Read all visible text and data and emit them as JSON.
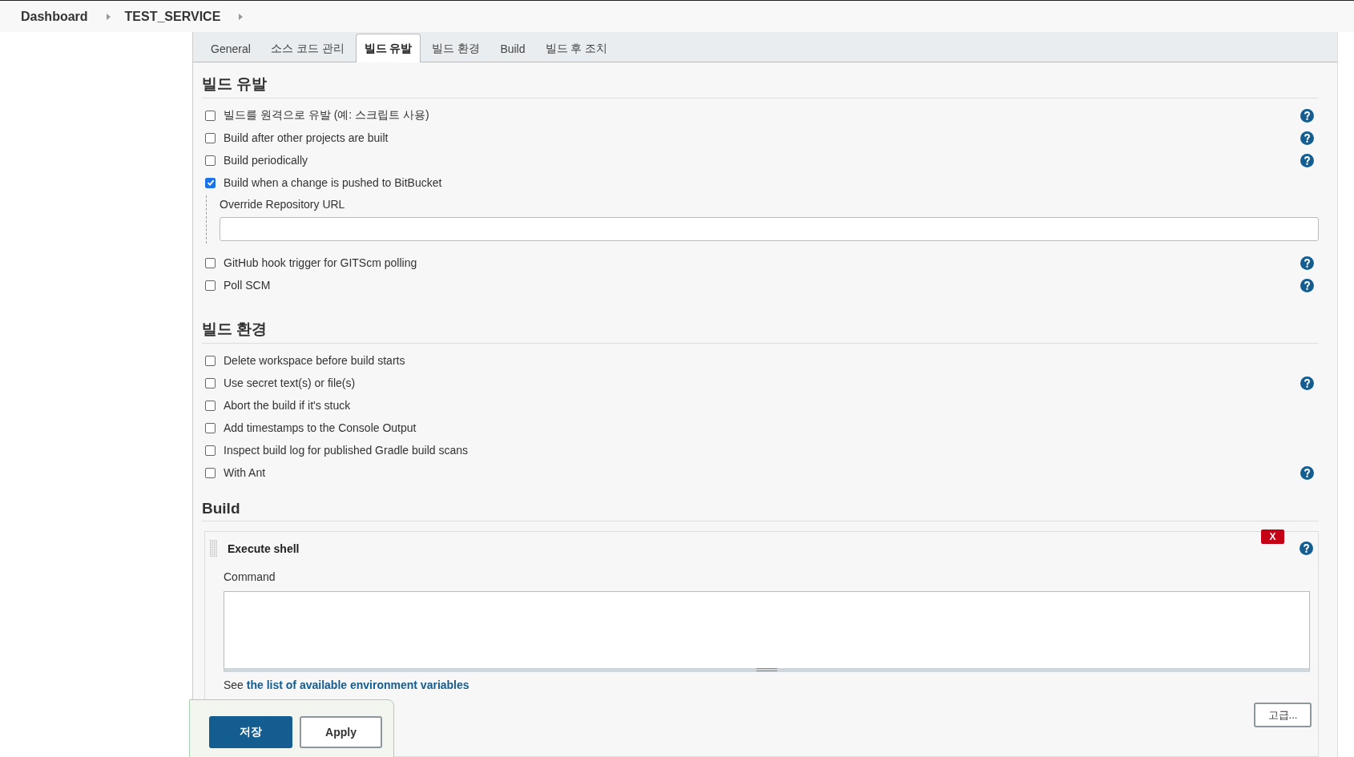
{
  "breadcrumbs": [
    {
      "label": "Dashboard"
    },
    {
      "label": "TEST_SERVICE"
    }
  ],
  "tabs": [
    {
      "label": "General",
      "selected": false
    },
    {
      "label": "소스 코드 관리",
      "selected": false
    },
    {
      "label": "빌드 유발",
      "selected": true
    },
    {
      "label": "빌드 환경",
      "selected": false
    },
    {
      "label": "Build",
      "selected": false
    },
    {
      "label": "빌드 후 조치",
      "selected": false
    }
  ],
  "sections": [
    {
      "title": "빌드 유발",
      "options": [
        {
          "label": "빌드를 원격으로 유발 (예: 스크립트 사용)",
          "checked": false,
          "help": true
        },
        {
          "label": "Build after other projects are built",
          "checked": false,
          "help": true
        },
        {
          "label": "Build periodically",
          "checked": false,
          "help": true
        },
        {
          "label": "Build when a change is pushed to BitBucket",
          "checked": true,
          "help": false,
          "field": {
            "label": "Override Repository URL"
          }
        },
        {
          "label": "GitHub hook trigger for GITScm polling",
          "checked": false,
          "help": true
        },
        {
          "label": "Poll SCM",
          "checked": false,
          "help": true
        }
      ]
    },
    {
      "title": "빌드 환경",
      "options": [
        {
          "label": "Delete workspace before build starts",
          "checked": false,
          "help": false
        },
        {
          "label": "Use secret text(s) or file(s)",
          "checked": false,
          "help": true
        },
        {
          "label": "Abort the build if it's stuck",
          "checked": false,
          "help": false
        },
        {
          "label": "Add timestamps to the Console Output",
          "checked": false,
          "help": false
        },
        {
          "label": "Inspect build log for published Gradle build scans",
          "checked": false,
          "help": false
        },
        {
          "label": "With Ant",
          "checked": false,
          "help": true
        }
      ]
    }
  ],
  "build": {
    "title": "Build",
    "step": {
      "title": "Execute shell",
      "delete_label": "X",
      "command_label": "Command",
      "hint_prefix": "See",
      "hint_link": "the list of available environment variables",
      "advanced_button": "고급..."
    }
  },
  "save_bar": {
    "save": "저장",
    "apply": "Apply"
  }
}
